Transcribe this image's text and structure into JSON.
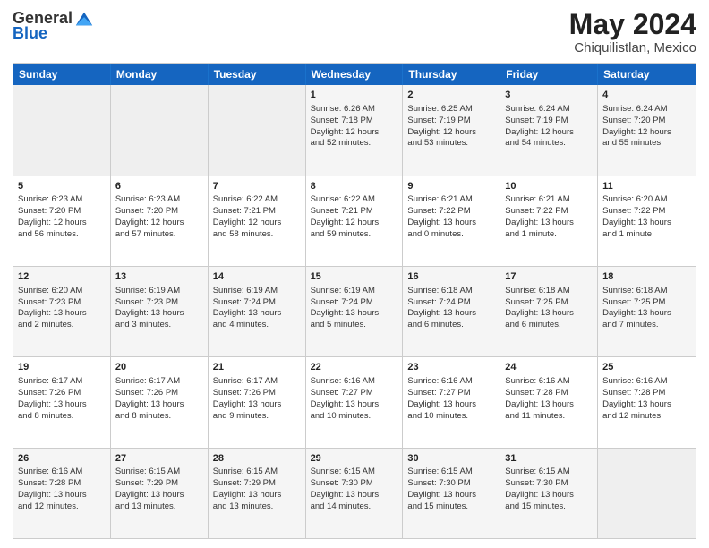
{
  "header": {
    "logo_general": "General",
    "logo_blue": "Blue",
    "month_title": "May 2024",
    "location": "Chiquilistlan, Mexico"
  },
  "days_of_week": [
    "Sunday",
    "Monday",
    "Tuesday",
    "Wednesday",
    "Thursday",
    "Friday",
    "Saturday"
  ],
  "weeks": [
    [
      {
        "day": "",
        "info": ""
      },
      {
        "day": "",
        "info": ""
      },
      {
        "day": "",
        "info": ""
      },
      {
        "day": "1",
        "info": "Sunrise: 6:26 AM\nSunset: 7:18 PM\nDaylight: 12 hours\nand 52 minutes."
      },
      {
        "day": "2",
        "info": "Sunrise: 6:25 AM\nSunset: 7:19 PM\nDaylight: 12 hours\nand 53 minutes."
      },
      {
        "day": "3",
        "info": "Sunrise: 6:24 AM\nSunset: 7:19 PM\nDaylight: 12 hours\nand 54 minutes."
      },
      {
        "day": "4",
        "info": "Sunrise: 6:24 AM\nSunset: 7:20 PM\nDaylight: 12 hours\nand 55 minutes."
      }
    ],
    [
      {
        "day": "5",
        "info": "Sunrise: 6:23 AM\nSunset: 7:20 PM\nDaylight: 12 hours\nand 56 minutes."
      },
      {
        "day": "6",
        "info": "Sunrise: 6:23 AM\nSunset: 7:20 PM\nDaylight: 12 hours\nand 57 minutes."
      },
      {
        "day": "7",
        "info": "Sunrise: 6:22 AM\nSunset: 7:21 PM\nDaylight: 12 hours\nand 58 minutes."
      },
      {
        "day": "8",
        "info": "Sunrise: 6:22 AM\nSunset: 7:21 PM\nDaylight: 12 hours\nand 59 minutes."
      },
      {
        "day": "9",
        "info": "Sunrise: 6:21 AM\nSunset: 7:22 PM\nDaylight: 13 hours\nand 0 minutes."
      },
      {
        "day": "10",
        "info": "Sunrise: 6:21 AM\nSunset: 7:22 PM\nDaylight: 13 hours\nand 1 minute."
      },
      {
        "day": "11",
        "info": "Sunrise: 6:20 AM\nSunset: 7:22 PM\nDaylight: 13 hours\nand 1 minute."
      }
    ],
    [
      {
        "day": "12",
        "info": "Sunrise: 6:20 AM\nSunset: 7:23 PM\nDaylight: 13 hours\nand 2 minutes."
      },
      {
        "day": "13",
        "info": "Sunrise: 6:19 AM\nSunset: 7:23 PM\nDaylight: 13 hours\nand 3 minutes."
      },
      {
        "day": "14",
        "info": "Sunrise: 6:19 AM\nSunset: 7:24 PM\nDaylight: 13 hours\nand 4 minutes."
      },
      {
        "day": "15",
        "info": "Sunrise: 6:19 AM\nSunset: 7:24 PM\nDaylight: 13 hours\nand 5 minutes."
      },
      {
        "day": "16",
        "info": "Sunrise: 6:18 AM\nSunset: 7:24 PM\nDaylight: 13 hours\nand 6 minutes."
      },
      {
        "day": "17",
        "info": "Sunrise: 6:18 AM\nSunset: 7:25 PM\nDaylight: 13 hours\nand 6 minutes."
      },
      {
        "day": "18",
        "info": "Sunrise: 6:18 AM\nSunset: 7:25 PM\nDaylight: 13 hours\nand 7 minutes."
      }
    ],
    [
      {
        "day": "19",
        "info": "Sunrise: 6:17 AM\nSunset: 7:26 PM\nDaylight: 13 hours\nand 8 minutes."
      },
      {
        "day": "20",
        "info": "Sunrise: 6:17 AM\nSunset: 7:26 PM\nDaylight: 13 hours\nand 8 minutes."
      },
      {
        "day": "21",
        "info": "Sunrise: 6:17 AM\nSunset: 7:26 PM\nDaylight: 13 hours\nand 9 minutes."
      },
      {
        "day": "22",
        "info": "Sunrise: 6:16 AM\nSunset: 7:27 PM\nDaylight: 13 hours\nand 10 minutes."
      },
      {
        "day": "23",
        "info": "Sunrise: 6:16 AM\nSunset: 7:27 PM\nDaylight: 13 hours\nand 10 minutes."
      },
      {
        "day": "24",
        "info": "Sunrise: 6:16 AM\nSunset: 7:28 PM\nDaylight: 13 hours\nand 11 minutes."
      },
      {
        "day": "25",
        "info": "Sunrise: 6:16 AM\nSunset: 7:28 PM\nDaylight: 13 hours\nand 12 minutes."
      }
    ],
    [
      {
        "day": "26",
        "info": "Sunrise: 6:16 AM\nSunset: 7:28 PM\nDaylight: 13 hours\nand 12 minutes."
      },
      {
        "day": "27",
        "info": "Sunrise: 6:15 AM\nSunset: 7:29 PM\nDaylight: 13 hours\nand 13 minutes."
      },
      {
        "day": "28",
        "info": "Sunrise: 6:15 AM\nSunset: 7:29 PM\nDaylight: 13 hours\nand 13 minutes."
      },
      {
        "day": "29",
        "info": "Sunrise: 6:15 AM\nSunset: 7:30 PM\nDaylight: 13 hours\nand 14 minutes."
      },
      {
        "day": "30",
        "info": "Sunrise: 6:15 AM\nSunset: 7:30 PM\nDaylight: 13 hours\nand 15 minutes."
      },
      {
        "day": "31",
        "info": "Sunrise: 6:15 AM\nSunset: 7:30 PM\nDaylight: 13 hours\nand 15 minutes."
      },
      {
        "day": "",
        "info": ""
      }
    ]
  ]
}
